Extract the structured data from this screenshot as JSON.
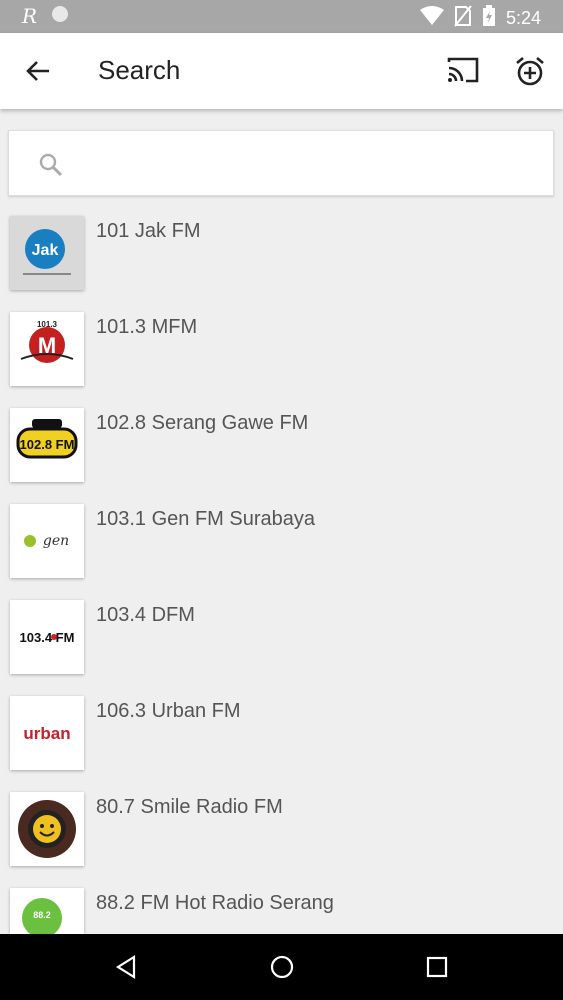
{
  "status_bar": {
    "time": "5:24"
  },
  "app_bar": {
    "title": "Search"
  },
  "search": {
    "value": "",
    "placeholder": ""
  },
  "stations": [
    {
      "name": "101 Jak FM",
      "logo_text": "Jak"
    },
    {
      "name": "101.3 MFM",
      "logo_text": "101.3"
    },
    {
      "name": "102.8 Serang Gawe FM",
      "logo_text": "102.8 FM"
    },
    {
      "name": "103.1 Gen FM Surabaya",
      "logo_text": "gen"
    },
    {
      "name": "103.4 DFM",
      "logo_text": "103.4 FM"
    },
    {
      "name": "106.3 Urban FM",
      "logo_text": "urban"
    },
    {
      "name": "80.7 Smile Radio FM",
      "logo_text": ""
    },
    {
      "name": "88.2 FM Hot Radio Serang",
      "logo_text": "88.2"
    }
  ],
  "colors": {
    "status_bar": "#a7a7a7",
    "app_bar": "#ffffff",
    "background": "#efefef",
    "nav_bar": "#000000"
  }
}
